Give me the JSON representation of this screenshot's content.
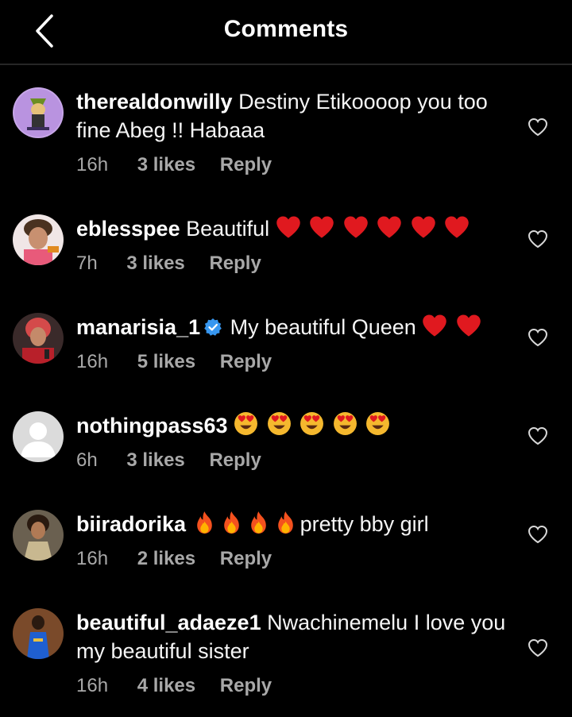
{
  "header": {
    "title": "Comments",
    "back_icon": "chevron-left-icon"
  },
  "colors": {
    "background": "#000000",
    "text": "#f5f5f5",
    "secondary": "#a8a8a8",
    "verified": "#3797f0",
    "heart_emoji": "#e0191f"
  },
  "comments": [
    {
      "username": "therealdonwilly",
      "text": "Destiny Etikoooop you too fine Abeg !! Habaaa",
      "time": "16h",
      "likes": "3 likes",
      "reply": "Reply",
      "emoji": []
    },
    {
      "username": "eblesspee",
      "text": "Beautiful",
      "time": "7h",
      "likes": "3 likes",
      "reply": "Reply",
      "emoji": [
        "red-heart",
        "red-heart",
        "red-heart",
        "red-heart",
        "red-heart",
        "red-heart"
      ]
    },
    {
      "username": "manarisia_1",
      "verified": true,
      "text": "My beautiful Queen",
      "time": "16h",
      "likes": "5 likes",
      "reply": "Reply",
      "emoji": [
        "red-heart",
        "red-heart"
      ]
    },
    {
      "username": "nothingpass63",
      "text": "",
      "time": "6h",
      "likes": "3 likes",
      "reply": "Reply",
      "emoji": [
        "heart-eyes",
        "heart-eyes",
        "heart-eyes",
        "heart-eyes",
        "heart-eyes"
      ]
    },
    {
      "username": "biiradorika",
      "text": "pretty bby girl",
      "time": "16h",
      "likes": "2 likes",
      "reply": "Reply",
      "emoji": [
        "fire",
        "fire",
        "fire",
        "fire"
      ]
    },
    {
      "username": "beautiful_adaeze1",
      "text": "Nwachinemelu I love you my beautiful sister",
      "time": "16h",
      "likes": "4 likes",
      "reply": "Reply",
      "emoji": []
    }
  ]
}
